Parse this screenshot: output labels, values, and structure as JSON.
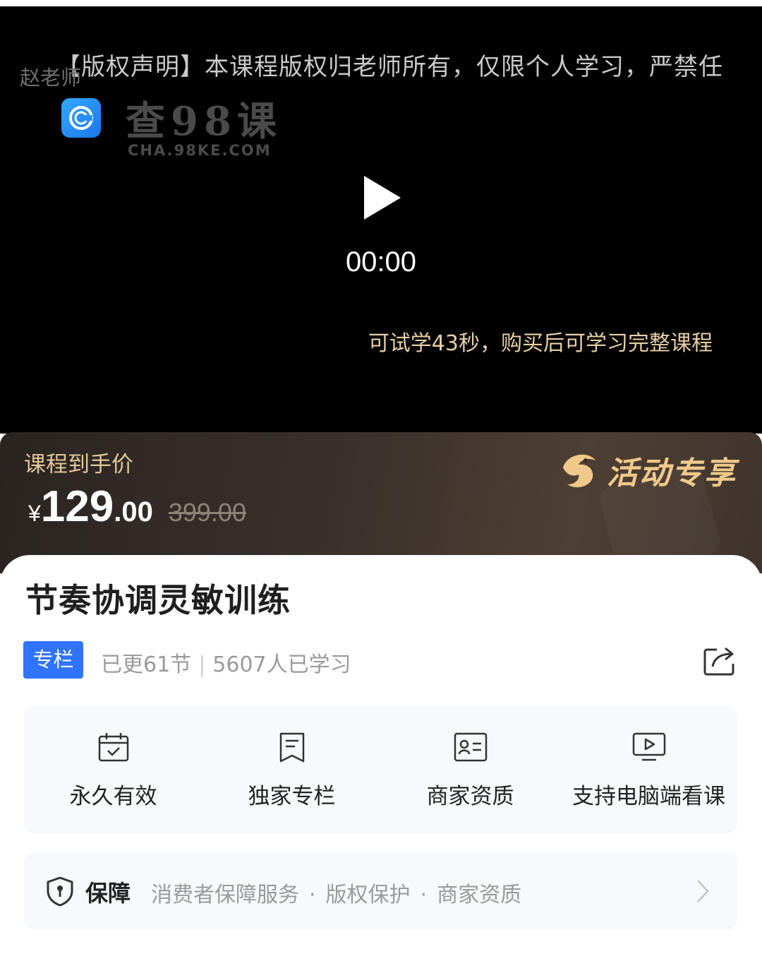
{
  "video": {
    "marquee_text": "【版权声明】本课程版权归老师所有，仅限个人学习，严禁任何形式的录制、传播和账号分享",
    "teacher_watermark": "赵老师",
    "watermark": {
      "title": "查98课",
      "url": "CHA.98KE.COM"
    },
    "play_icon": "play-icon",
    "timecode": "00:00",
    "trial_notice": "可试学43秒，购买后可学习完整课程"
  },
  "price": {
    "label": "课程到手价",
    "currency": "¥",
    "integer": "129",
    "decimal": ".00",
    "original": "399.00",
    "promo_label": "活动专享",
    "promo_icon": "mascot-icon",
    "colors": {
      "gold": "#e3c79c",
      "banner": "#3a312b"
    }
  },
  "course": {
    "title": "节奏协调灵敏训练",
    "tag": "专栏",
    "updated": "已更61节",
    "learners": "5607人已学习",
    "share_icon": "share-icon"
  },
  "features": [
    {
      "icon": "calendar-check-icon",
      "label": "永久有效"
    },
    {
      "icon": "bookmark-doc-icon",
      "label": "独家专栏"
    },
    {
      "icon": "id-card-icon",
      "label": "商家资质"
    },
    {
      "icon": "monitor-play-icon",
      "label": "支持电脑端看课"
    }
  ],
  "guarantee": {
    "icon": "shield-icon",
    "title": "保障",
    "items": [
      "消费者保障服务",
      "版权保护",
      "商家资质"
    ],
    "separator": "·",
    "arrow_icon": "chevron-right-icon"
  },
  "accent_color": "#2f74ff"
}
